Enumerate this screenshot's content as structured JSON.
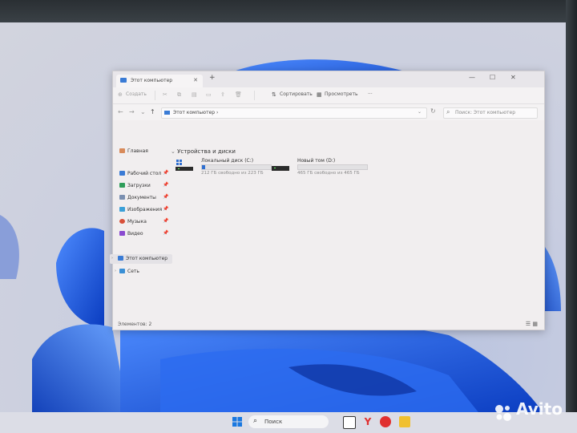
{
  "window": {
    "tab_title": "Этот компьютер",
    "tab_close": "✕",
    "new_tab": "+",
    "controls": {
      "minimize": "—",
      "maximize": "☐",
      "close": "✕"
    }
  },
  "toolbar": {
    "create_label": "Создать",
    "sort_label": "Сортировать",
    "view_label": "Просмотреть",
    "more_label": "···"
  },
  "address": {
    "path": "Этот компьютер  ›",
    "search_placeholder": "Поиск: Этот компьютер"
  },
  "sidebar": {
    "items": [
      {
        "label": "Главная",
        "icon": "home-icon"
      },
      {
        "label": "Рабочий стол",
        "icon": "desktop-icon",
        "pinned": true
      },
      {
        "label": "Загрузки",
        "icon": "download-icon",
        "pinned": true
      },
      {
        "label": "Документы",
        "icon": "documents-icon",
        "pinned": true
      },
      {
        "label": "Изображения",
        "icon": "pictures-icon",
        "pinned": true
      },
      {
        "label": "Музыка",
        "icon": "music-icon",
        "pinned": true
      },
      {
        "label": "Видео",
        "icon": "video-icon",
        "pinned": true
      },
      {
        "label": "Этот компьютер",
        "icon": "computer-icon",
        "selected": true
      },
      {
        "label": "Сеть",
        "icon": "network-icon"
      }
    ]
  },
  "content": {
    "section_title": "Устройства и диски",
    "drives": [
      {
        "name": "Локальный диск (C:)",
        "free_text": "212 ГБ свободно из 223 ГБ",
        "used_fraction": 0.05
      },
      {
        "name": "Новый том (D:)",
        "free_text": "465 ГБ свободно из 465 ГБ",
        "used_fraction": 0.0
      }
    ]
  },
  "status": {
    "items_count": "Элементов: 2"
  },
  "taskbar": {
    "search_label": "Поиск"
  },
  "watermark": "Avito",
  "colors": {
    "accent": "#2f6fd0",
    "wallpaper_blue": "#1a5fe0"
  }
}
